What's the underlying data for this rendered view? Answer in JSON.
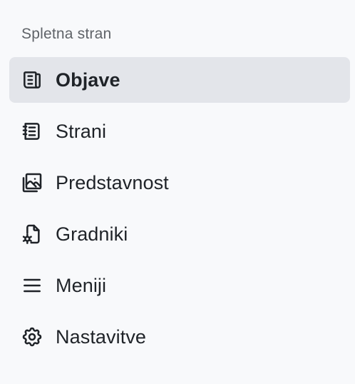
{
  "sidebar": {
    "section_title": "Spletna stran",
    "active_index": 0,
    "items": [
      {
        "label": "Objave",
        "icon": "newspaper-icon",
        "active": true
      },
      {
        "label": "Strani",
        "icon": "notebook-icon",
        "active": false
      },
      {
        "label": "Predstavnost",
        "icon": "photos-icon",
        "active": false
      },
      {
        "label": "Gradniki",
        "icon": "file-gear-icon",
        "active": false
      },
      {
        "label": "Meniji",
        "icon": "menu-lines-icon",
        "active": false
      },
      {
        "label": "Nastavitve",
        "icon": "gear-icon",
        "active": false
      }
    ]
  },
  "colors": {
    "background": "#f8f9fb",
    "active_item_background": "#e3e5ea",
    "text": "#1f2328",
    "section_title": "#5f6368"
  }
}
